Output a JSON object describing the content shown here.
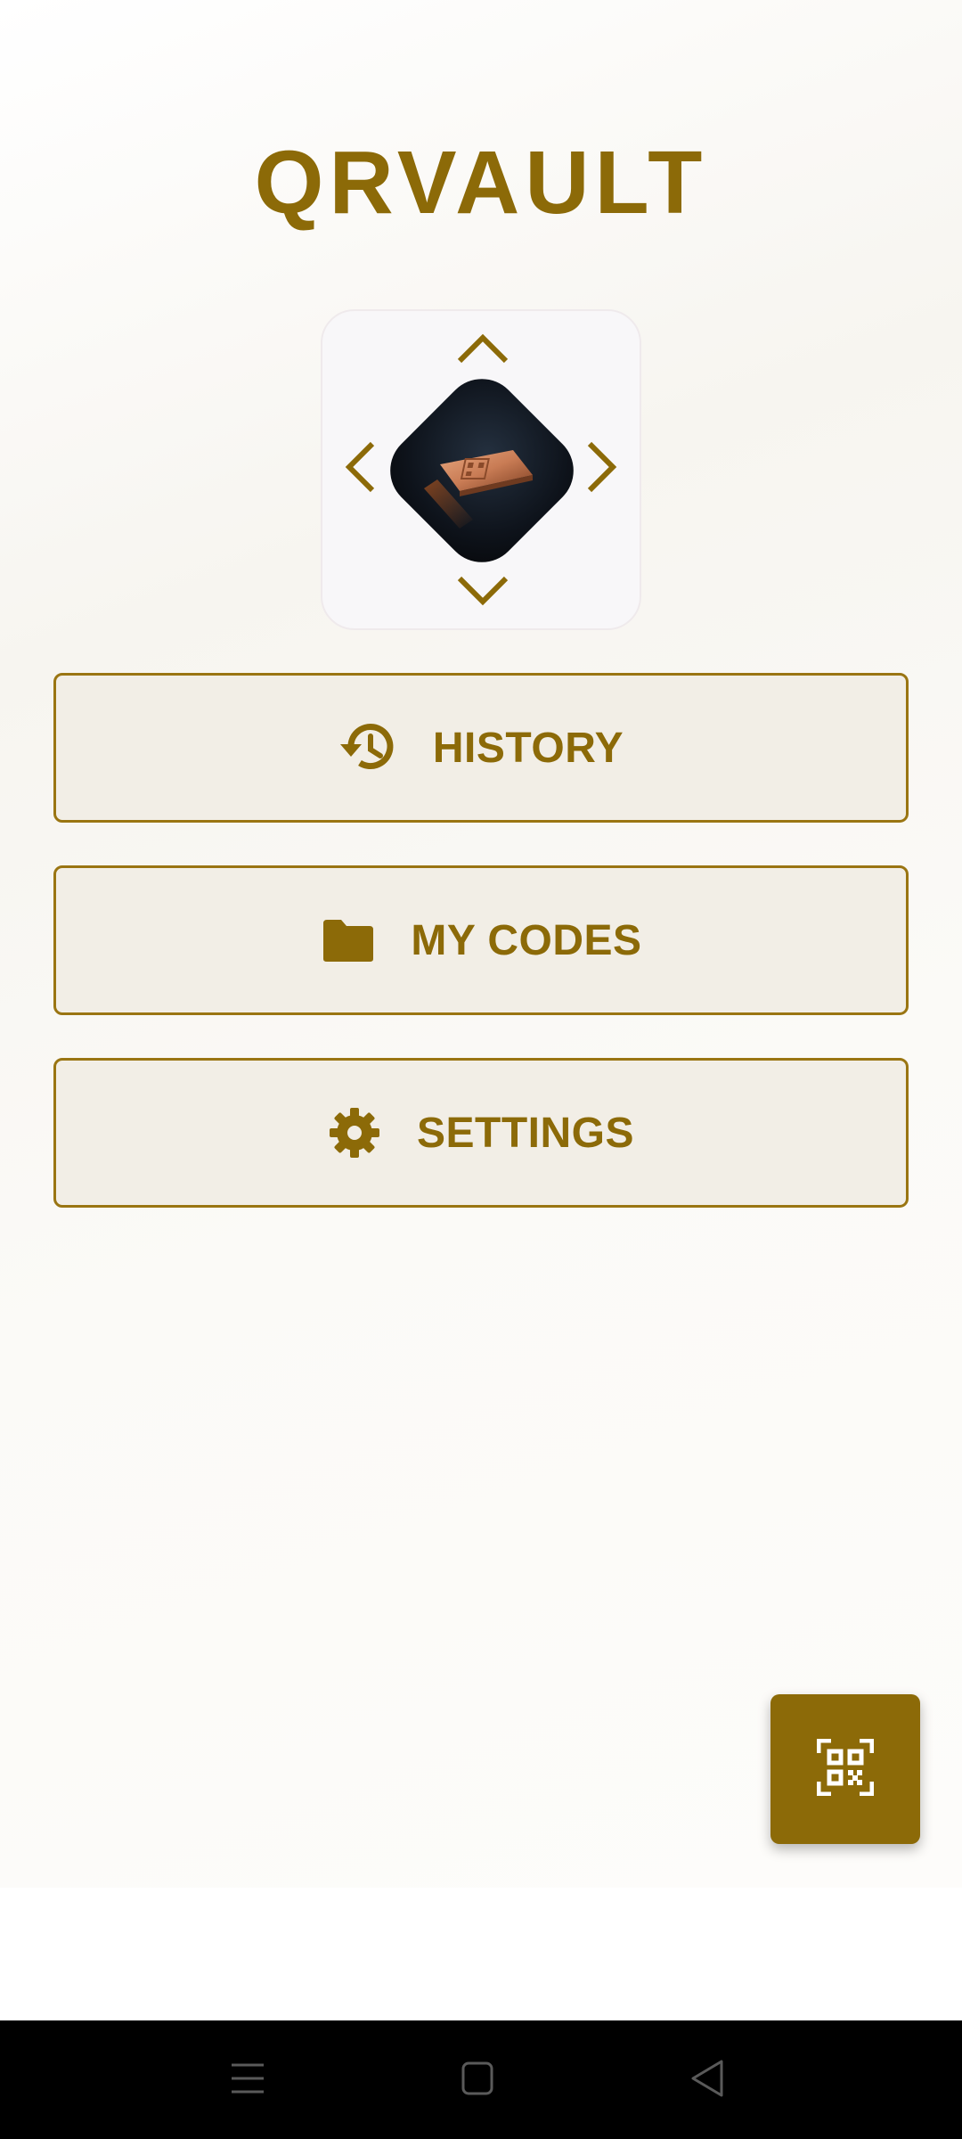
{
  "app": {
    "title": "QRVAULT",
    "accent_color": "#8c6a08"
  },
  "logo": {
    "icons": [
      "arrow-up-icon",
      "arrow-down-icon",
      "arrow-left-icon",
      "arrow-right-icon",
      "qr-device-logo"
    ]
  },
  "menu": {
    "items": [
      {
        "label": "HISTORY",
        "icon": "history-icon"
      },
      {
        "label": "MY CODES",
        "icon": "folder-icon"
      },
      {
        "label": "SETTINGS",
        "icon": "gear-icon"
      }
    ]
  },
  "fab": {
    "icon": "qr-scan-icon"
  },
  "system_nav": {
    "icons": [
      "menu-icon",
      "home-icon",
      "back-icon"
    ]
  }
}
